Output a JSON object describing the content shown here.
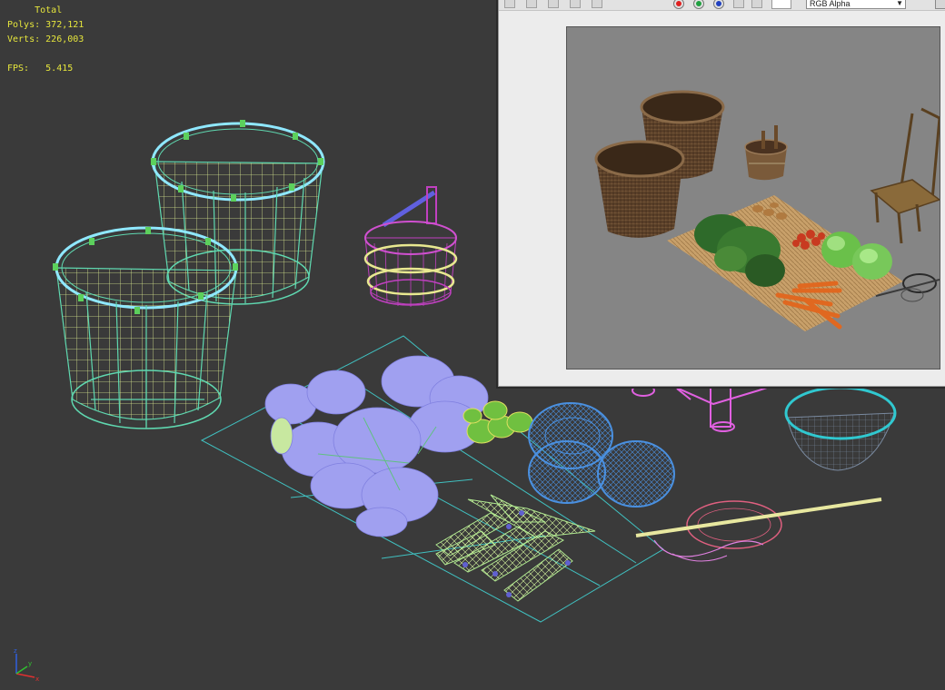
{
  "viewport": {
    "label": "Perspective viewport",
    "stats": {
      "heading": "Total",
      "polys_label": "Polys:",
      "polys_value": "372,121",
      "verts_label": "Verts:",
      "verts_value": "226,003",
      "fps_label": "FPS:",
      "fps_value": "5.415"
    },
    "axis_labels": {
      "x": "x",
      "y": "y",
      "z": "z"
    }
  },
  "render_window": {
    "channel_display": "RGB Alpha",
    "channel_buttons": [
      {
        "name": "red-channel",
        "color": "#e02020"
      },
      {
        "name": "green-channel",
        "color": "#20a040"
      },
      {
        "name": "blue-channel",
        "color": "#2040c0"
      }
    ]
  },
  "colors": {
    "viewport_bg": "#3a3a3a",
    "stats_text": "#e6e63c",
    "basket_wire": "#5fd8b0",
    "bucket_wire": "#c040c0",
    "greens_wire": "#9090f0",
    "cabbage_wire": "#4a90e0",
    "carrot_wire": "#b0e890",
    "mat_wire": "#40c0c0",
    "chair_wire": "#e060e0",
    "sieve_wire": "#e06080",
    "render_bg": "#858585"
  }
}
